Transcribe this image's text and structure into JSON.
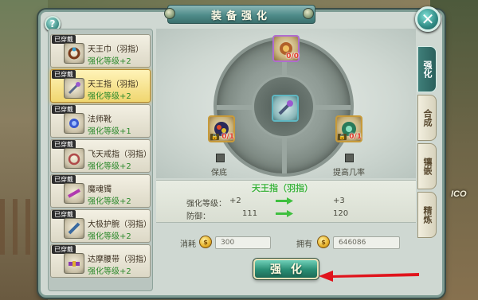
{
  "window": {
    "title": "装备强化",
    "close_label": "✕",
    "help_label": "?"
  },
  "items": [
    {
      "badge": "已穿戴",
      "name": "天王巾（羽指）",
      "level": "强化等级+2",
      "selected": false
    },
    {
      "badge": "已穿戴",
      "name": "天王指（羽指）",
      "level": "强化等级+2",
      "selected": true
    },
    {
      "badge": "已穿戴",
      "name": "法师靴",
      "level": "强化等级+1",
      "selected": false
    },
    {
      "badge": "已穿戴",
      "name": "飞天戒指（羽指）",
      "level": "强化等级+2",
      "selected": false
    },
    {
      "badge": "已穿戴",
      "name": "魔魂镯",
      "level": "强化等级+2",
      "selected": false
    },
    {
      "badge": "已穿戴",
      "name": "大极护腕（羽指）",
      "level": "强化等级+2",
      "selected": false
    },
    {
      "badge": "已穿戴",
      "name": "达摩腰带（羽指）",
      "level": "强化等级+2",
      "selected": false
    }
  ],
  "slots": {
    "top_count": "0/0",
    "left_count": "0/1",
    "right_count": "0/1",
    "left_label": "保底",
    "right_label": "提高几率"
  },
  "stats": {
    "item_name": "天王指（羽指）",
    "rows": [
      {
        "label": "强化等级：",
        "from": "+2",
        "to": "+3"
      },
      {
        "label": "防御：",
        "from": "111",
        "to": "120"
      }
    ]
  },
  "cost": {
    "consume_label": "消耗",
    "consume_value": "300",
    "own_label": "拥有",
    "own_value": "646086"
  },
  "enhance_button": "强化",
  "tabs": [
    "强化",
    "合成",
    "镶嵌",
    "精炼"
  ],
  "colors": {
    "accent": "#2a8e74",
    "stat_highlight": "#3fb33f",
    "level_text": "#2c8a2c",
    "count_red": "#e23a2a",
    "annotation": "#e0141c"
  },
  "scene": {
    "logo_text": "ICO"
  }
}
